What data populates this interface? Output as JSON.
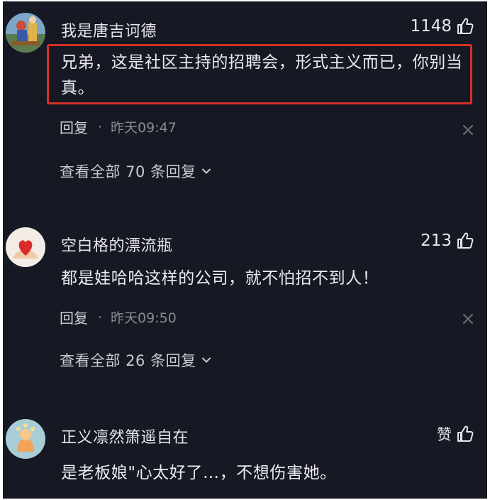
{
  "comments": [
    {
      "username": "我是唐吉诃德",
      "likes": "1148",
      "text_line1": "兄弟，这是社区主持的招聘会，形式主义而已，你别当",
      "text_line2": "真。",
      "reply_label": "回复",
      "timestamp": "昨天09:47",
      "view_replies": "查看全部 70 条回复"
    },
    {
      "username": "空白格的漂流瓶",
      "likes": "213",
      "text": "都是娃哈哈这样的公司，就不怕招不到人！",
      "reply_label": "回复",
      "timestamp": "昨天09:50",
      "view_replies": "查看全部 26 条回复"
    },
    {
      "username": "正义凛然箫遥自在",
      "likes": "赞",
      "text": "是老板娘\"心太好了…，不想伤害她。"
    }
  ],
  "colors": {
    "background": "#161823",
    "highlight_border": "#d5302b",
    "muted_text": "#8a8b91"
  }
}
